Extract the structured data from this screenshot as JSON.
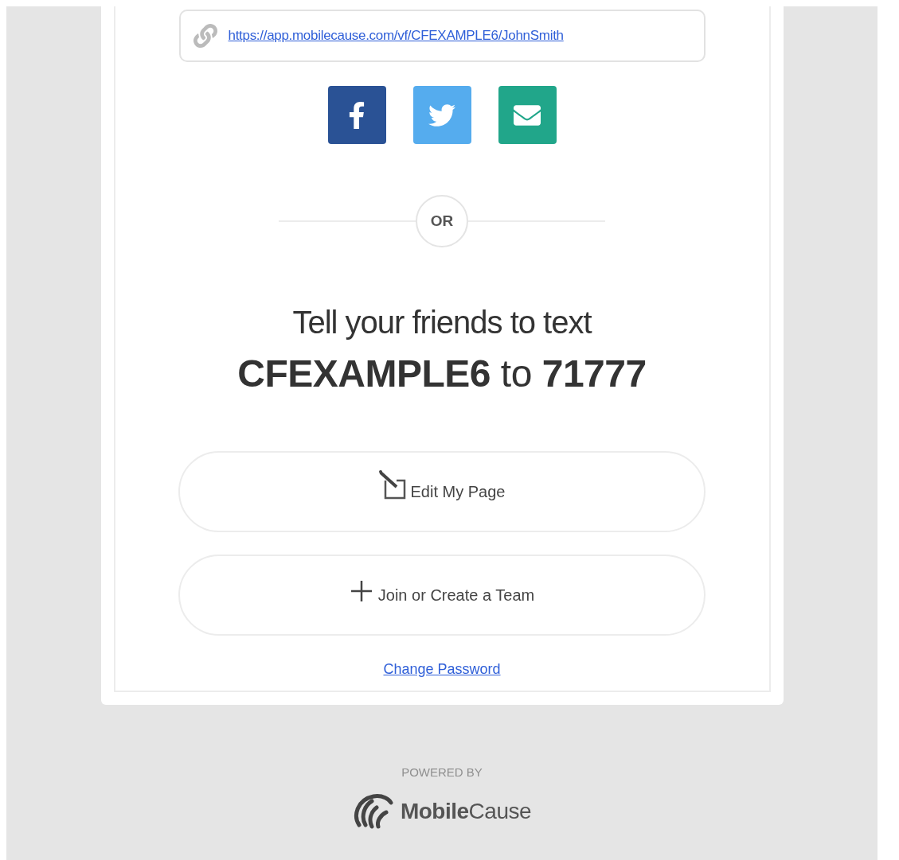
{
  "share_link": {
    "url": "https://app.mobilecause.com/vf/CFEXAMPLE6/JohnSmith"
  },
  "share_buttons": [
    {
      "kind": "facebook",
      "color": "#2a5295"
    },
    {
      "kind": "twitter",
      "color": "#55acee"
    },
    {
      "kind": "email",
      "color": "#21a68a"
    }
  ],
  "divider": {
    "label": "OR"
  },
  "text_prompt": {
    "line_1": "Tell your friends to text",
    "line_2": "**CFEXAMPLE6** to **71777**"
  },
  "actions": [
    {
      "kind": "edit",
      "label": "Edit My Page"
    },
    {
      "kind": "add",
      "label": "Join or Create a Team"
    }
  ],
  "change_password_link": "Change Password",
  "footer": {
    "powered_by": "POWERED BY",
    "logo_text": "**Mobile**Cause"
  }
}
